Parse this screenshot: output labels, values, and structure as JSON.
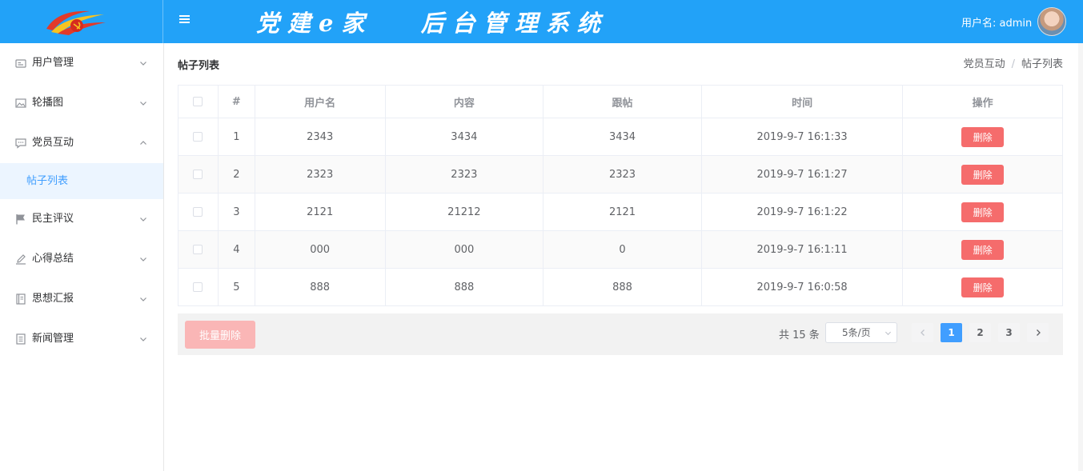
{
  "header": {
    "title": "党建e家   后台管理系统",
    "user_label": "用户名: admin",
    "brand_color": "#22a2f8"
  },
  "sidebar": {
    "items": [
      {
        "label": "用户管理",
        "icon": "user-card-icon"
      },
      {
        "label": "轮播图",
        "icon": "image-icon"
      },
      {
        "label": "党员互动",
        "icon": "chat-icon",
        "expanded": true,
        "children": [
          {
            "label": "帖子列表",
            "active": true
          }
        ]
      },
      {
        "label": "民主评议",
        "icon": "flag-icon"
      },
      {
        "label": "心得总结",
        "icon": "edit-icon"
      },
      {
        "label": "思想汇报",
        "icon": "notebook-icon"
      },
      {
        "label": "新闻管理",
        "icon": "document-icon"
      }
    ]
  },
  "main": {
    "title": "帖子列表",
    "breadcrumb": [
      "党员互动",
      "帖子列表"
    ],
    "breadcrumb_sep": "/"
  },
  "table": {
    "columns": [
      "",
      "#",
      "用户名",
      "内容",
      "跟帖",
      "时间",
      "操作"
    ],
    "rows": [
      {
        "index": "1",
        "username": "2343",
        "content": "3434",
        "reply": "3434",
        "time": "2019-9-7 16:1:33"
      },
      {
        "index": "2",
        "username": "2323",
        "content": "2323",
        "reply": "2323",
        "time": "2019-9-7 16:1:27"
      },
      {
        "index": "3",
        "username": "2121",
        "content": "21212",
        "reply": "2121",
        "time": "2019-9-7 16:1:22"
      },
      {
        "index": "4",
        "username": "000",
        "content": "000",
        "reply": "0",
        "time": "2019-9-7 16:1:11"
      },
      {
        "index": "5",
        "username": "888",
        "content": "888",
        "reply": "888",
        "time": "2019-9-7 16:0:58"
      }
    ],
    "delete_label": "删除",
    "delete_color": "#f56c6c"
  },
  "footer": {
    "batch_delete_label": "批量删除",
    "total_text": "共 15 条",
    "page_size": "5条/页",
    "pages": [
      "1",
      "2",
      "3"
    ],
    "current_page": "1"
  }
}
